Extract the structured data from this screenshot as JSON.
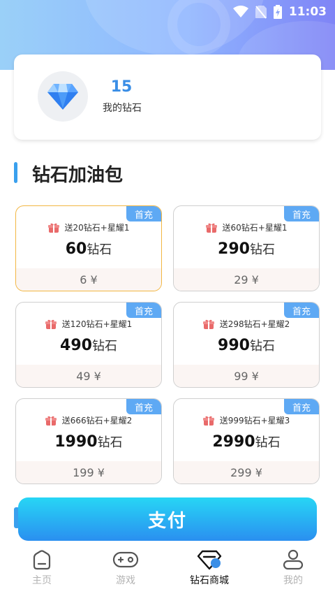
{
  "status_bar": {
    "time": "11:03"
  },
  "wallet": {
    "count": "15",
    "label": "我的钻石"
  },
  "section": {
    "title": "钻石加油包"
  },
  "packages": [
    {
      "badge": "首充",
      "bonus": "送20钻石+星耀1",
      "amount": "60",
      "unit": "钻石",
      "price": "6 ¥",
      "selected": true
    },
    {
      "badge": "首充",
      "bonus": "送60钻石+星耀1",
      "amount": "290",
      "unit": "钻石",
      "price": "29 ¥",
      "selected": false
    },
    {
      "badge": "首充",
      "bonus": "送120钻石+星耀1",
      "amount": "490",
      "unit": "钻石",
      "price": "49 ¥",
      "selected": false
    },
    {
      "badge": "首充",
      "bonus": "送298钻石+星耀2",
      "amount": "990",
      "unit": "钻石",
      "price": "99 ¥",
      "selected": false
    },
    {
      "badge": "首充",
      "bonus": "送666钻石+星耀2",
      "amount": "1990",
      "unit": "钻石",
      "price": "199 ¥",
      "selected": false
    },
    {
      "badge": "首充",
      "bonus": "送999钻石+星耀3",
      "amount": "2990",
      "unit": "钻石",
      "price": "299 ¥",
      "selected": false
    }
  ],
  "pay": {
    "label": "支付"
  },
  "tabs": [
    {
      "label": "主页",
      "icon": "home-icon",
      "active": false
    },
    {
      "label": "游戏",
      "icon": "gamepad-icon",
      "active": false
    },
    {
      "label": "钻石商城",
      "icon": "diamond-shop-icon",
      "active": true
    },
    {
      "label": "我的",
      "icon": "profile-icon",
      "active": false
    }
  ],
  "colors": {
    "accent": "#3a8ee6",
    "badge": "#5ea9f4",
    "selected_border": "#f2b642",
    "pay_gradient_top": "#27d6f5",
    "pay_gradient_bottom": "#2a8ff0"
  }
}
